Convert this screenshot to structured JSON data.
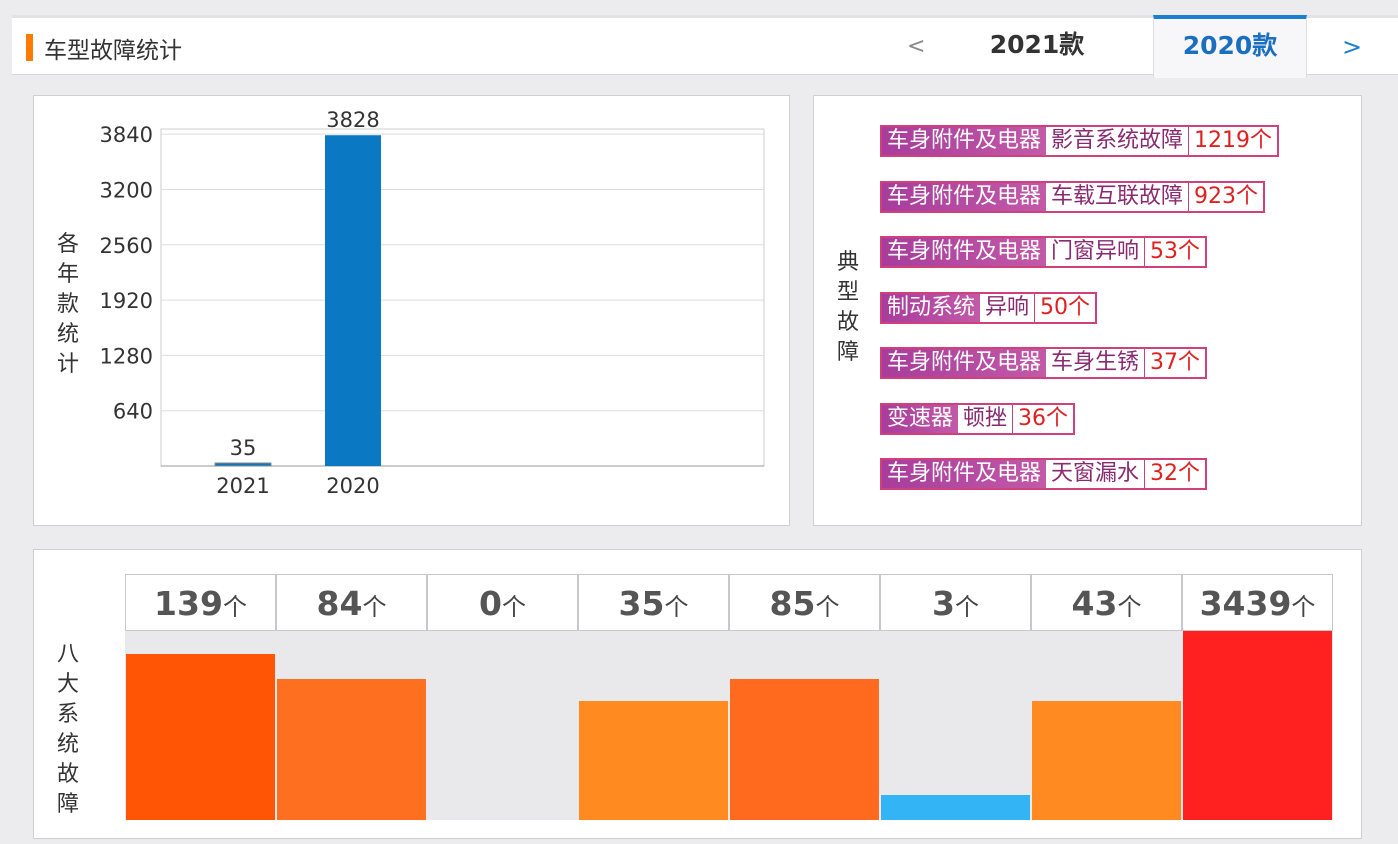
{
  "header": {
    "title": "车型故障统计",
    "prev": "<",
    "next": ">",
    "tabs": [
      {
        "label": "2021款",
        "active": false
      },
      {
        "label": "2020款",
        "active": true
      }
    ]
  },
  "chart_data": {
    "type": "bar",
    "ylabel": "各年款统计",
    "categories": [
      "2021",
      "2020"
    ],
    "values": [
      35,
      3828
    ],
    "yticks": [
      640,
      1280,
      1920,
      2560,
      3200,
      3840
    ],
    "ylim": [
      0,
      3900
    ],
    "color": "#0a78c2"
  },
  "typical": {
    "label": "典型故障",
    "items": [
      {
        "system": "车身附件及电器",
        "issue": "影音系统故障",
        "count": "1219个"
      },
      {
        "system": "车身附件及电器",
        "issue": "车载互联故障",
        "count": "923个"
      },
      {
        "system": "车身附件及电器",
        "issue": "门窗异响",
        "count": "53个"
      },
      {
        "system": "制动系统",
        "issue": "异响",
        "count": "50个"
      },
      {
        "system": "车身附件及电器",
        "issue": "车身生锈",
        "count": "37个"
      },
      {
        "system": "变速器",
        "issue": "顿挫",
        "count": "36个"
      },
      {
        "system": "车身附件及电器",
        "issue": "天窗漏水",
        "count": "32个"
      }
    ]
  },
  "eight": {
    "label": "八大系统故障",
    "unit": "个",
    "items": [
      {
        "count": "139",
        "level": 0.88,
        "color": "#ff5505"
      },
      {
        "count": "84",
        "level": 0.745,
        "color": "#ff6f1f"
      },
      {
        "count": "0",
        "level": 0,
        "color": "#ff8a1f"
      },
      {
        "count": "35",
        "level": 0.63,
        "color": "#ff8a1f"
      },
      {
        "count": "85",
        "level": 0.745,
        "color": "#ff6a1f"
      },
      {
        "count": "3",
        "level": 0.13,
        "color": "#33b5f5"
      },
      {
        "count": "43",
        "level": 0.63,
        "color": "#ff8a22"
      },
      {
        "count": "3439",
        "level": 1.0,
        "color": "#ff2020"
      }
    ]
  }
}
